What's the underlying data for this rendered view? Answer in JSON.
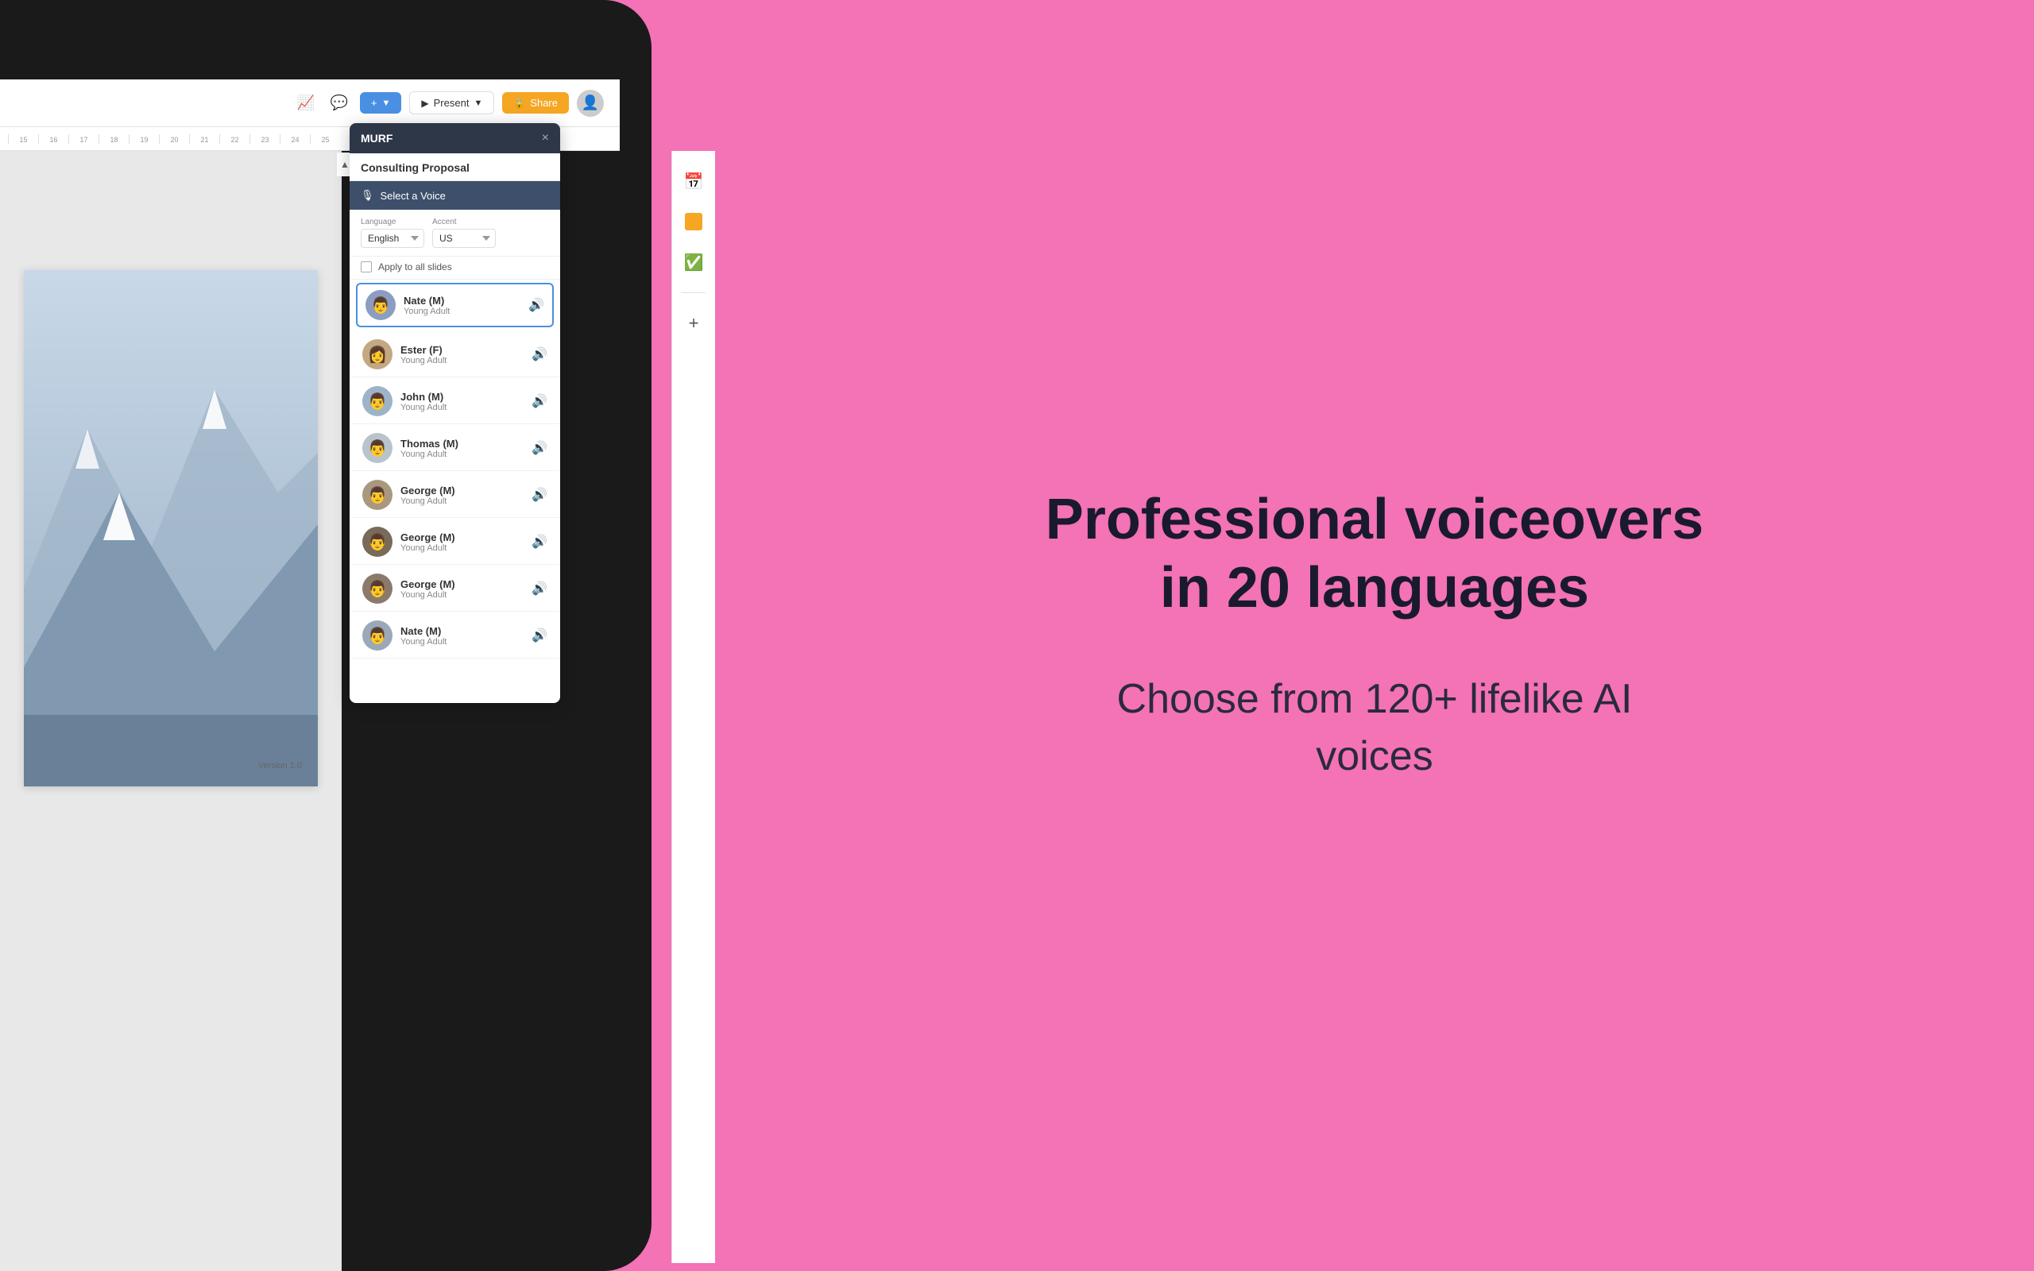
{
  "background_color": "#F472B6",
  "laptop": {
    "toolbar": {
      "add_button": "+",
      "present_button": "Present",
      "share_button": "Share",
      "trend_icon": "📈",
      "comment_icon": "💬"
    },
    "ruler": {
      "marks": [
        "15",
        "16",
        "17",
        "18",
        "19",
        "20",
        "21",
        "22",
        "23",
        "24",
        "25"
      ]
    },
    "slide": {
      "version_text": "Version 1.0"
    }
  },
  "murf_dialog": {
    "header_title": "MURF",
    "close_label": "×",
    "document_title": "Consulting Proposal",
    "select_voice_label": "Select a Voice",
    "language_label": "Language",
    "language_value": "English",
    "accent_label": "Accent",
    "accent_value": "US",
    "apply_all_label": "Apply to all slides",
    "voices": [
      {
        "id": "nate",
        "name": "Nate (M)",
        "type": "Young Adult",
        "selected": true,
        "avatar_color": "#8B9DC3"
      },
      {
        "id": "ester",
        "name": "Ester (F)",
        "type": "Young Adult",
        "selected": false,
        "avatar_color": "#C4A882"
      },
      {
        "id": "john",
        "name": "John (M)",
        "type": "Young Adult",
        "selected": false,
        "avatar_color": "#9DB3C8"
      },
      {
        "id": "thomas",
        "name": "Thomas (M)",
        "type": "Young Adult",
        "selected": false,
        "avatar_color": "#B8C4CC"
      },
      {
        "id": "george1",
        "name": "George (M)",
        "type": "Young Adult",
        "selected": false,
        "avatar_color": "#A89880"
      },
      {
        "id": "george2",
        "name": "George (M)",
        "type": "Young Adult",
        "selected": false,
        "avatar_color": "#7A6A5A"
      },
      {
        "id": "george3",
        "name": "George (M)",
        "type": "Young Adult",
        "selected": false,
        "avatar_color": "#8B7A6A"
      },
      {
        "id": "nate2",
        "name": "Nate (M)",
        "type": "Young Adult",
        "selected": false,
        "avatar_color": "#9BA8B8"
      }
    ]
  },
  "right_sidebar_icons": [
    {
      "id": "calendar",
      "symbol": "📅",
      "color": "#4285F4"
    },
    {
      "id": "sticky-note",
      "symbol": "🟡",
      "color": "#F5A623"
    },
    {
      "id": "check",
      "symbol": "✅",
      "color": "#34A853"
    },
    {
      "id": "plus",
      "symbol": "+",
      "color": "#555"
    }
  ],
  "marketing": {
    "heading": "Professional voiceovers\nin 20 languages",
    "subtext": "Choose from 120+ lifelike AI voices"
  }
}
